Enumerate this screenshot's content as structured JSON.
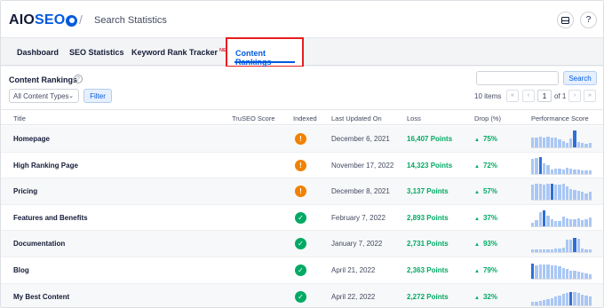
{
  "header": {
    "logo_main": "AIOSEO",
    "separator": "/",
    "breadcrumb": "Search Statistics",
    "help_glyph": "?"
  },
  "tabs": [
    {
      "label": "Dashboard"
    },
    {
      "label": "SEO Statistics"
    },
    {
      "label": "Keyword Rank Tracker",
      "badge": "NEW!"
    },
    {
      "label": "Content Rankings",
      "active": true
    }
  ],
  "content": {
    "title": "Content Rankings",
    "help_glyph": "?",
    "filter_select": "All Content Types",
    "filter_button": "Filter",
    "search_placeholder": "",
    "search_button": "Search",
    "items_count": "10 items",
    "page_first": "«",
    "page_prev": "‹",
    "page_current": "1",
    "page_of": "of 1",
    "page_next": "›",
    "page_last": "»"
  },
  "table": {
    "columns": [
      "Title",
      "TruSEO Score",
      "Indexed",
      "Last Updated On",
      "Loss",
      "Drop (%)",
      "Performance Score"
    ],
    "rows": [
      {
        "title": "Homepage",
        "indexed": "warning",
        "date": "December 6, 2021",
        "loss": "16,407 Points",
        "drop": "75%",
        "spark": [
          0.55,
          0.55,
          0.6,
          0.55,
          0.6,
          0.55,
          0.55,
          0.45,
          0.35,
          0.25,
          0.5,
          0.95,
          0.3,
          0.25,
          0.2,
          0.25
        ],
        "spark_hi": [
          11
        ]
      },
      {
        "title": "High Ranking Page",
        "indexed": "warning",
        "date": "November 17, 2022",
        "loss": "14,323 Points",
        "drop": "72%",
        "spark": [
          0.85,
          0.9,
          0.95,
          0.6,
          0.5,
          0.25,
          0.3,
          0.3,
          0.25,
          0.35,
          0.3,
          0.25,
          0.25,
          0.2,
          0.2,
          0.2
        ],
        "spark_hi": [
          2
        ]
      },
      {
        "title": "Pricing",
        "indexed": "warning",
        "date": "December 8, 2021",
        "loss": "3,137 Points",
        "drop": "57%",
        "spark": [
          0.85,
          0.9,
          0.9,
          0.85,
          0.9,
          0.9,
          0.85,
          0.85,
          0.9,
          0.75,
          0.6,
          0.55,
          0.5,
          0.45,
          0.35,
          0.45
        ],
        "spark_hi": [
          5
        ]
      },
      {
        "title": "Features and Benefits",
        "indexed": "ok",
        "date": "February 7, 2022",
        "loss": "2,893 Points",
        "drop": "37%",
        "spark": [
          0.2,
          0.35,
          0.8,
          0.9,
          0.6,
          0.4,
          0.3,
          0.3,
          0.55,
          0.45,
          0.4,
          0.4,
          0.45,
          0.35,
          0.4,
          0.5
        ],
        "spark_hi": [
          3
        ]
      },
      {
        "title": "Documentation",
        "indexed": "ok",
        "date": "January 7, 2022",
        "loss": "2,731 Points",
        "drop": "93%",
        "spark": [
          0.15,
          0.15,
          0.15,
          0.15,
          0.15,
          0.15,
          0.2,
          0.2,
          0.25,
          0.7,
          0.7,
          0.8,
          0.75,
          0.2,
          0.15,
          0.15
        ],
        "spark_hi": [
          11
        ]
      },
      {
        "title": "Blog",
        "indexed": "ok",
        "date": "April 21, 2022",
        "loss": "2,363 Points",
        "drop": "79%",
        "spark": [
          0.85,
          0.75,
          0.8,
          0.8,
          0.8,
          0.75,
          0.75,
          0.7,
          0.6,
          0.55,
          0.45,
          0.45,
          0.4,
          0.35,
          0.3,
          0.25
        ],
        "spark_hi": [
          0
        ]
      },
      {
        "title": "My Best Content",
        "indexed": "ok",
        "date": "April 22, 2022",
        "loss": "2,272 Points",
        "drop": "32%",
        "spark": [
          0.2,
          0.2,
          0.25,
          0.3,
          0.35,
          0.4,
          0.5,
          0.55,
          0.65,
          0.7,
          0.75,
          0.75,
          0.7,
          0.6,
          0.55,
          0.5
        ],
        "spark_hi": [
          10
        ]
      }
    ]
  },
  "colors": {
    "brand": "#005ae0",
    "active_tab_highlight": "#e81d1d",
    "positive": "#00aa63",
    "warning": "#f18200"
  },
  "icons": {
    "indexed_warning": "exclamation-icon",
    "indexed_ok": "check-icon",
    "drop_trend": "triangle-up-icon"
  }
}
